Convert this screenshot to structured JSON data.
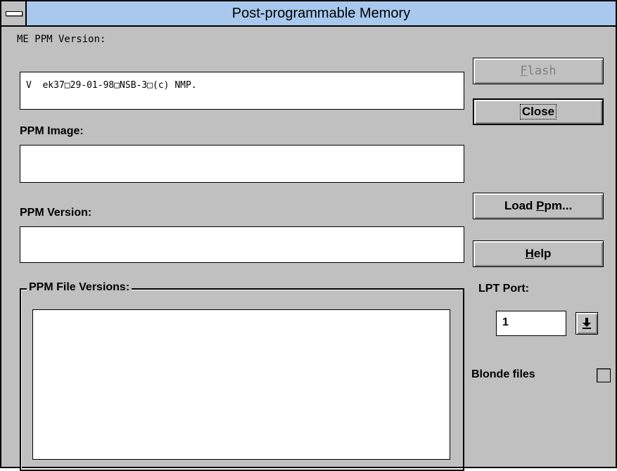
{
  "window": {
    "title": "Post-programmable Memory"
  },
  "me_ppm_version": {
    "label": "ME PPM Version:",
    "value": "V  ek37□29-01-98□NSB-3□(c) NMP."
  },
  "ppm_image": {
    "label": "PPM Image:",
    "value": ""
  },
  "ppm_version": {
    "label": "PPM Version:",
    "value": ""
  },
  "ppm_file_versions": {
    "label": "PPM File Versions:",
    "items": []
  },
  "buttons": {
    "flash": {
      "mnemonic": "F",
      "rest": "lash",
      "enabled": false
    },
    "close": {
      "label": "Close"
    },
    "load_ppm": {
      "before": "Load ",
      "mnemonic": "P",
      "rest": "pm..."
    },
    "help": {
      "mnemonic": "H",
      "rest": "elp"
    }
  },
  "lpt_port": {
    "label": "LPT Port:",
    "value": "1"
  },
  "blonde_files": {
    "label": "Blonde files",
    "checked": false
  },
  "colors": {
    "title_bar": "#a9c8ee",
    "face": "#c0c0c0",
    "disabled_text": "#808080"
  },
  "icons": {
    "system_menu": "system-menu-icon",
    "dropdown": "down-arrow-icon"
  }
}
